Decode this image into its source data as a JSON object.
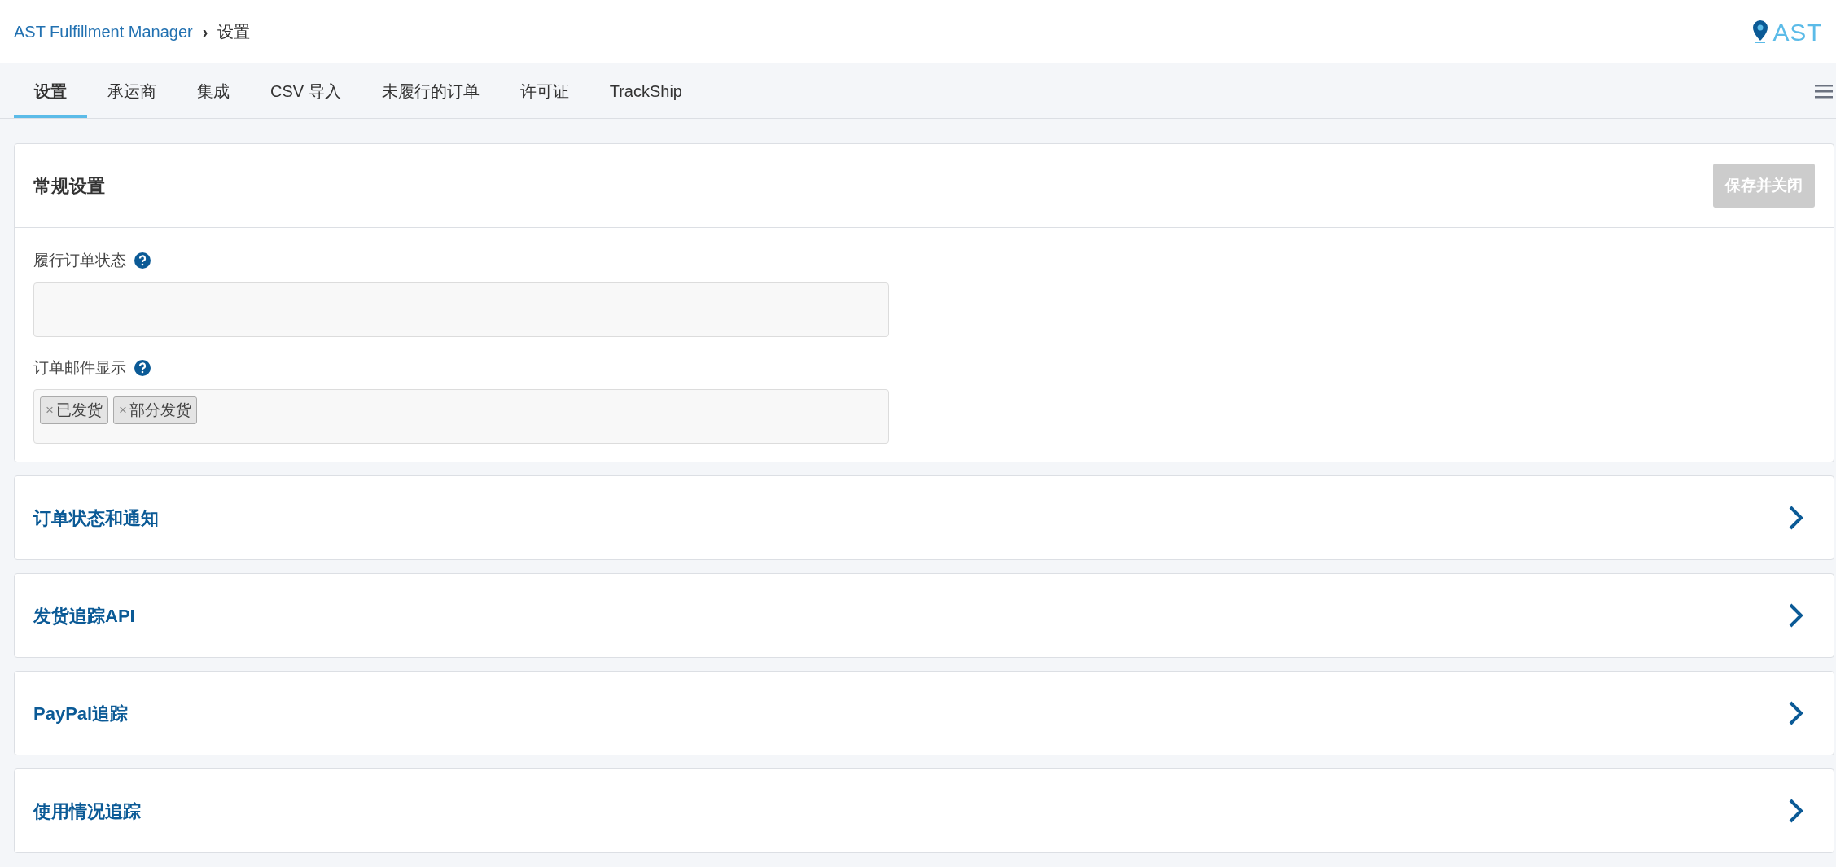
{
  "breadcrumb": {
    "parent": "AST Fulfillment Manager",
    "separator": "›",
    "current": "设置"
  },
  "logo": {
    "text": "AST"
  },
  "tabs": [
    {
      "label": "设置",
      "selected": true
    },
    {
      "label": "承运商",
      "selected": false
    },
    {
      "label": "集成",
      "selected": false
    },
    {
      "label": "CSV 导入",
      "selected": false
    },
    {
      "label": "未履行的订单",
      "selected": false
    },
    {
      "label": "许可证",
      "selected": false
    },
    {
      "label": "TrackShip",
      "selected": false
    }
  ],
  "general_settings": {
    "title": "常规设置",
    "save_button": {
      "label": "保存并关闭",
      "disabled": true
    },
    "fields": [
      {
        "label": "履行订单状态"
      },
      {
        "label": "订单邮件显示",
        "tags": [
          {
            "remove": "×",
            "label": "已发货"
          },
          {
            "remove": "×",
            "label": "部分发货"
          }
        ]
      }
    ]
  },
  "sections": [
    {
      "title": "订单状态和通知",
      "expanded": false
    },
    {
      "title": "发货追踪API",
      "expanded": false
    },
    {
      "title": "PayPal追踪",
      "expanded": false
    },
    {
      "title": "使用情况追踪",
      "expanded": false
    }
  ]
}
